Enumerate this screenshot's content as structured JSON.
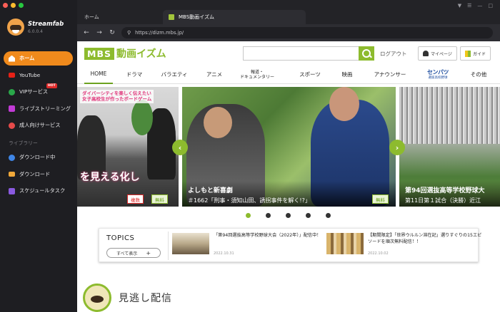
{
  "app": {
    "name": "Streamfab",
    "version": "6.0.0.4"
  },
  "sidebar": {
    "items": [
      {
        "label": "ホーム",
        "icon": "home-icon",
        "active": true
      },
      {
        "label": "YouTube",
        "icon": "youtube-icon"
      },
      {
        "label": "VIPサービス",
        "icon": "vip-icon",
        "badge": "HOT"
      },
      {
        "label": "ライブストリーミング",
        "icon": "live-icon"
      },
      {
        "label": "成人向けサービス",
        "icon": "adult-icon"
      }
    ],
    "section_label": "ライブラリー",
    "library": [
      {
        "label": "ダウンロード中",
        "icon": "downloading-icon"
      },
      {
        "label": "ダウンロード",
        "icon": "folder-icon"
      },
      {
        "label": "スケジュールタスク",
        "icon": "schedule-icon"
      }
    ]
  },
  "tabs": {
    "home": "ホーム",
    "active": "MBS動画イズム"
  },
  "address": {
    "url": "https://dizm.mbs.jp/"
  },
  "site": {
    "logo_box": "MBS",
    "logo_title": "動画イズム",
    "login": "ログアウト",
    "mypage": "マイページ",
    "guide": "ガイド",
    "menu": [
      "HOME",
      "ドラマ",
      "バラエティ",
      "アニメ",
      "報道・",
      "ドキュメンタリー",
      "スポーツ",
      "映画",
      "アナウンサー",
      "センバツ",
      "選抜高校野球",
      "その他"
    ]
  },
  "carousel": {
    "slide1": {
      "headline1": "ダイバーシティを楽しく伝えたい",
      "headline2": "女子高校生が作ったボードゲーム",
      "big": "を見える化し",
      "badge_multi": "複数",
      "badge_free": "無料"
    },
    "slide2": {
      "title": "よしもと新喜劇",
      "subtitle": "＃1662「刑事・須知山田、誘拐事件を解く!?」",
      "badge_free": "無料"
    },
    "slide3": {
      "title": "第94回選抜高等学校野球大",
      "subtitle": "第11日第１試合（決勝）近江"
    }
  },
  "topics": {
    "title": "TOPICS",
    "all": "すべて表示",
    "items": [
      {
        "text": "「第94回選抜高等学校野球大会（2022年）」配信中！",
        "date": "2022.10.31"
      },
      {
        "text": "【期間限定】「世界ウルルン滞在記」選りすぐりの15エピソードを順次無料配信！！",
        "date": "2022.10.02"
      }
    ]
  },
  "section": {
    "title": "見逃し配信"
  },
  "colors": {
    "accent": "#f08a1c",
    "brand_green": "#8dbb2e",
    "sidebar_bg": "#1e1e22"
  }
}
